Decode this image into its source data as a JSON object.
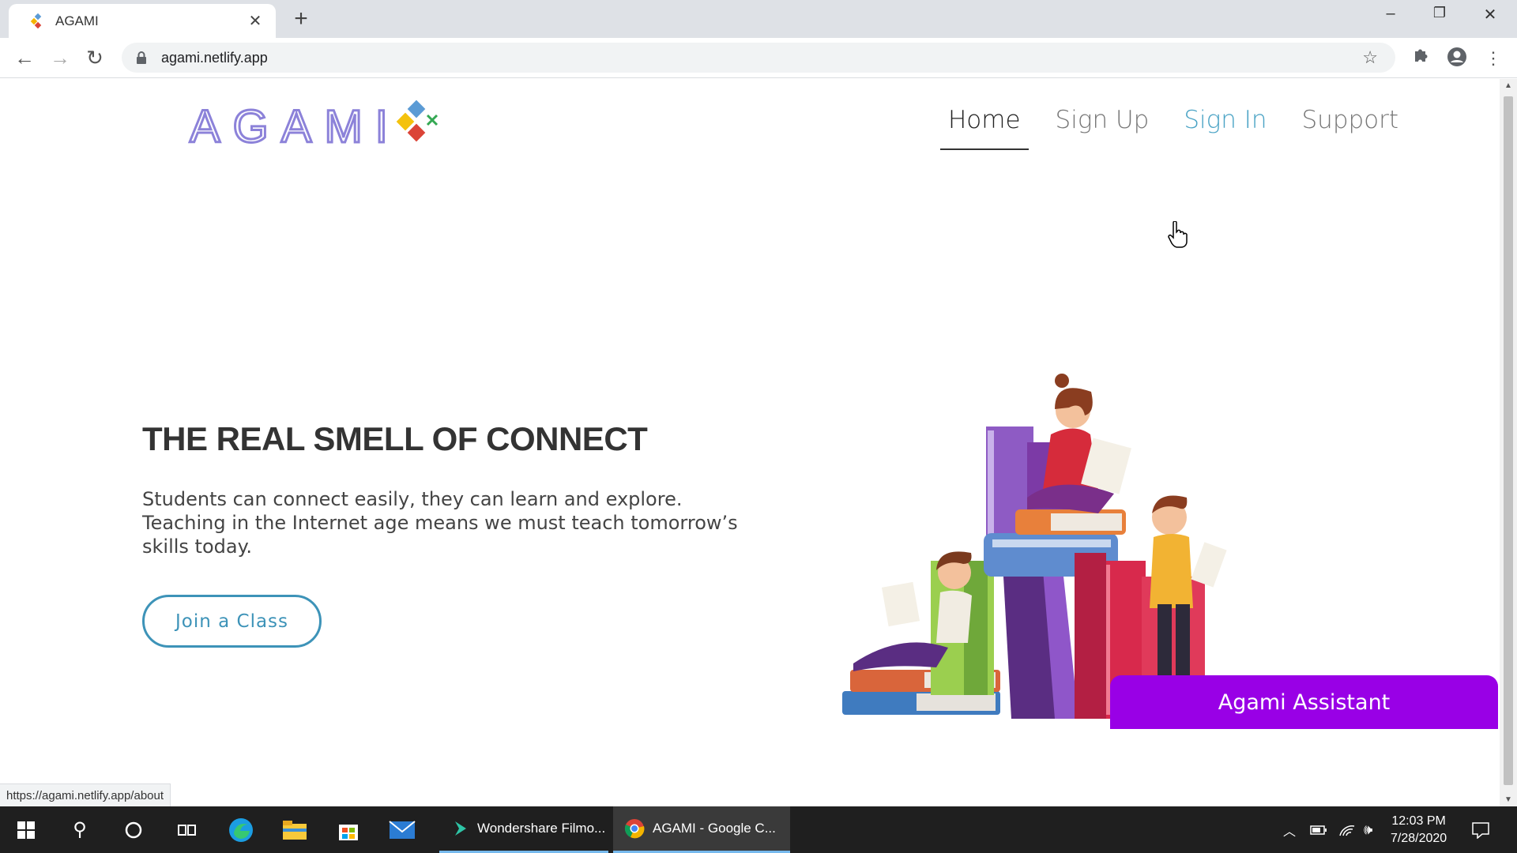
{
  "browser": {
    "tab_title": "AGAMI",
    "tab_close": "✕",
    "new_tab": "+",
    "url": "agami.netlify.app",
    "status_url": "https://agami.netlify.app/about"
  },
  "site": {
    "logo_text": "AGAMI",
    "nav": [
      {
        "label": "Home"
      },
      {
        "label": "Sign Up"
      },
      {
        "label": "Sign In"
      },
      {
        "label": "Support"
      }
    ],
    "hero": {
      "title": "THE REAL SMELL OF CONNECT",
      "text": "Students can connect easily, they can learn and explore. Teaching in the Internet age means we must teach tomorrow’s skills today.",
      "cta": "Join a Class"
    },
    "assistant_label": "Agami Assistant"
  },
  "taskbar": {
    "apps": [
      {
        "label": "Wondershare Filmo..."
      },
      {
        "label": "AGAMI - Google C..."
      }
    ],
    "time": "12:03 PM",
    "date": "7/28/2020"
  },
  "colors": {
    "accent_purple": "#9900e6",
    "cta_blue": "#3d93b8",
    "logo_outline": "#8c82d9"
  }
}
